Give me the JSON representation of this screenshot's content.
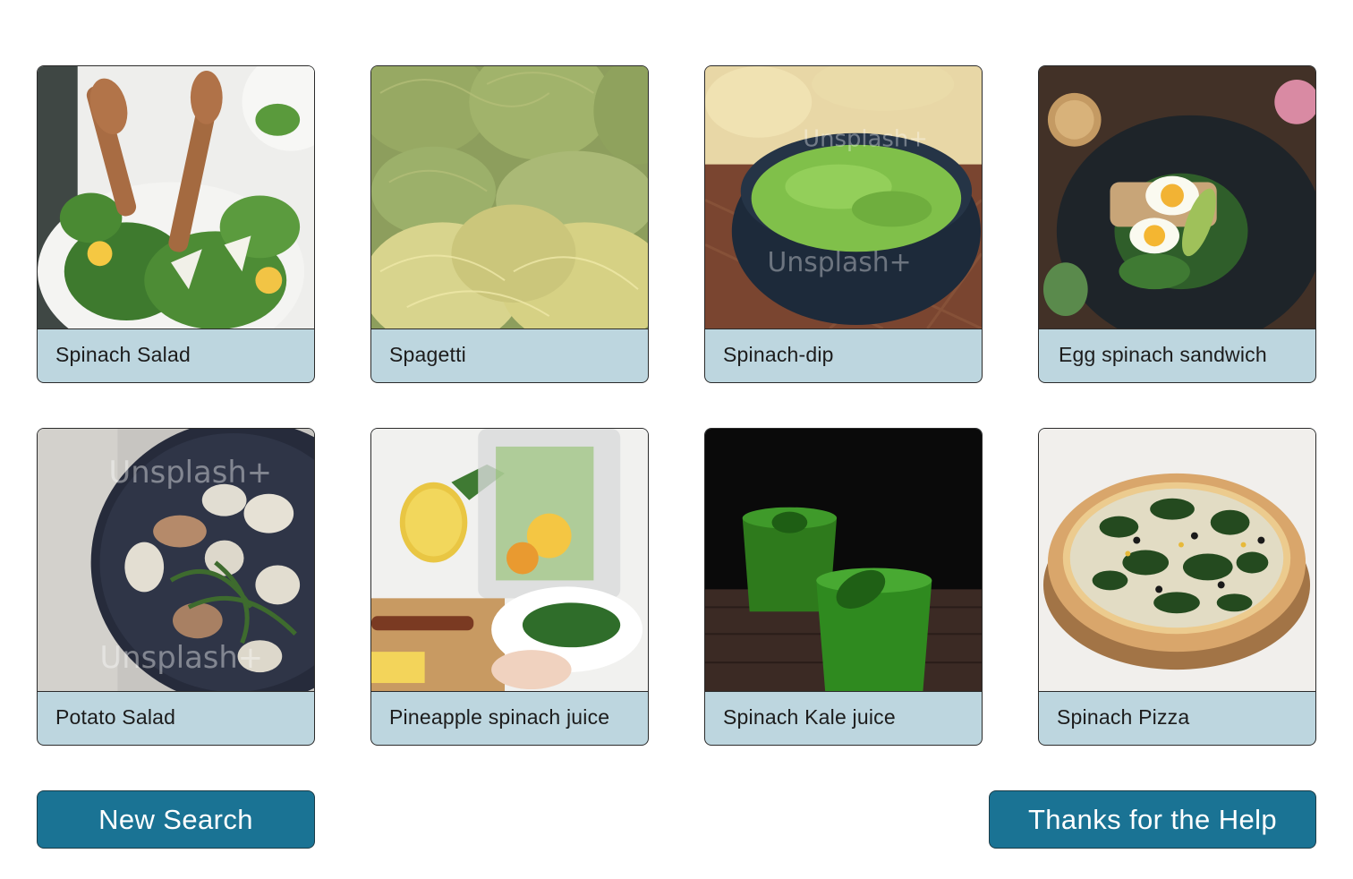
{
  "results": [
    {
      "label": "Spinach Salad",
      "image_alt": "Spinach salad with wooden servers, lemon and parmesan"
    },
    {
      "label": "Spagetti",
      "image_alt": "Nests of green and yellow spaghetti"
    },
    {
      "label": "Spinach-dip",
      "image_alt": "Bowl of green spinach dip with chips"
    },
    {
      "label": "Egg spinach sandwich",
      "image_alt": "Open sandwich with boiled egg and spinach on dark plate"
    },
    {
      "label": "Potato Salad",
      "image_alt": "Roasted potatoes with greens on a dark plate"
    },
    {
      "label": "Pineapple spinach juice",
      "image_alt": "Blender with pineapple and spinach"
    },
    {
      "label": "Spinach Kale juice",
      "image_alt": "Two glasses of green juice on dark background"
    },
    {
      "label": "Spinach Pizza",
      "image_alt": "Pizza topped with spinach and olives"
    }
  ],
  "actions": {
    "new_search_label": "New Search",
    "thanks_label": "Thanks for the Help"
  },
  "colors": {
    "caption_bg": "#bdd6df",
    "button_bg": "#1a7394",
    "button_text": "#ffffff"
  }
}
